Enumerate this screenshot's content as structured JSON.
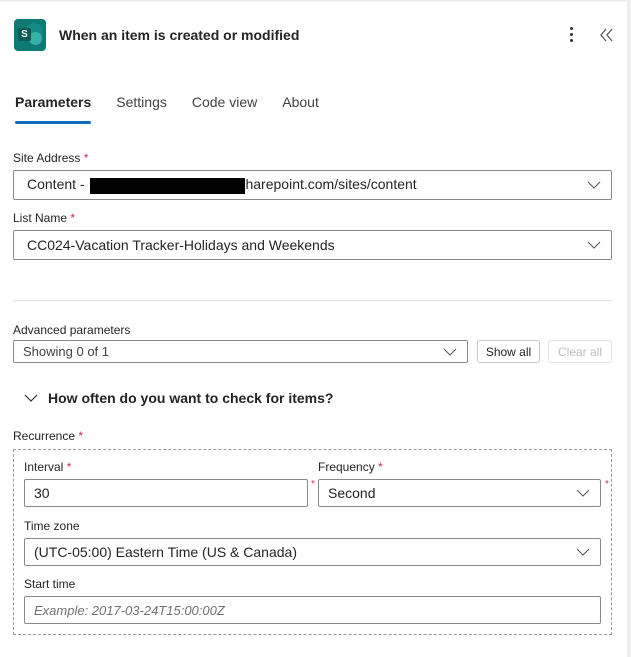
{
  "header": {
    "title": "When an item is created or modified",
    "app_icon": "sharepoint-icon",
    "app_icon_letter": "S",
    "more_icon": "more-vertical-icon",
    "collapse_icon": "double-chevron-left-icon"
  },
  "tabs": [
    {
      "label": "Parameters",
      "active": true
    },
    {
      "label": "Settings",
      "active": false
    },
    {
      "label": "Code view",
      "active": false
    },
    {
      "label": "About",
      "active": false
    }
  ],
  "site_address": {
    "label": "Site Address",
    "required_mark": "*",
    "value_prefix": "Content - ",
    "value_suffix": "harepoint.com/sites/content"
  },
  "list_name": {
    "label": "List Name",
    "required_mark": "*",
    "value": "CC024-Vacation Tracker-Holidays and Weekends"
  },
  "advanced": {
    "label": "Advanced parameters",
    "value": "Showing 0 of 1",
    "show_all": "Show all",
    "clear_all": "Clear all"
  },
  "section": {
    "title": "How often do you want to check for items?"
  },
  "recurrence": {
    "label": "Recurrence",
    "required_mark": "*",
    "interval_label": "Interval",
    "interval_value": "30",
    "frequency_label": "Frequency",
    "frequency_value": "Second",
    "timezone_label": "Time zone",
    "timezone_value": "(UTC-05:00) Eastern Time (US & Canada)",
    "start_label": "Start time",
    "start_placeholder": "Example: 2017-03-24T15:00:00Z"
  },
  "colors": {
    "accent": "#0f6cbd",
    "required": "#c4314b",
    "brand": "#0e7a73"
  }
}
